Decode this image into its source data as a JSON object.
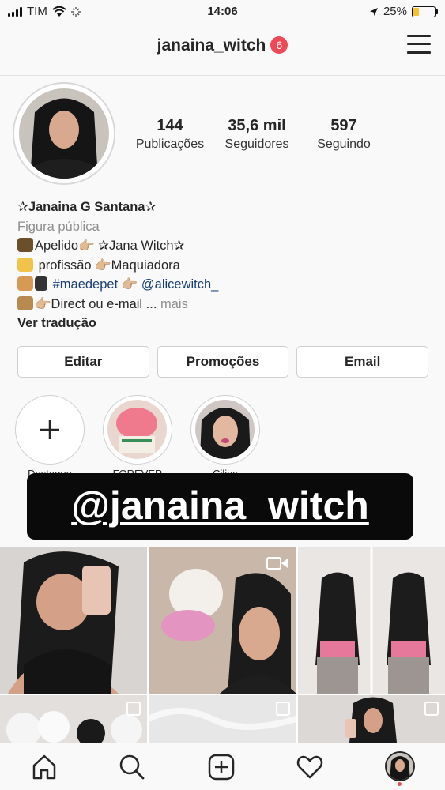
{
  "status": {
    "carrier": "TIM",
    "time": "14:06",
    "battery": "25%",
    "battery_level": 0.25
  },
  "header": {
    "username": "janaina_witch",
    "notifications": "6"
  },
  "stats": [
    {
      "value": "144",
      "label": "Publicações"
    },
    {
      "value": "35,6 mil",
      "label": "Seguidores"
    },
    {
      "value": "597",
      "label": "Seguindo"
    }
  ],
  "bio": {
    "name": "✰Janaina G Santana✰",
    "category": "Figura pública",
    "line1": "Apelido👉🏼 ✰Jana Witch✰",
    "line2": "profissão 👉🏼Maquiadora",
    "line3_hashtag": "#maedepet",
    "line3_sep": "👉🏼",
    "line3_mention": "@alicewitch_",
    "line4": "👉🏼Direct ou e-mail ...",
    "more": "mais",
    "translate": "Ver tradução"
  },
  "buttons": {
    "edit": "Editar",
    "promotions": "Promoções",
    "email": "Email"
  },
  "highlights": [
    {
      "label": "Destaque"
    },
    {
      "label": "FOREVER"
    },
    {
      "label": "Cilios"
    }
  ],
  "overlay_text": "@janaina_witch",
  "colors": {
    "accent": "#ed4956",
    "link": "#1b3f78",
    "muted": "#8e8e8e"
  }
}
